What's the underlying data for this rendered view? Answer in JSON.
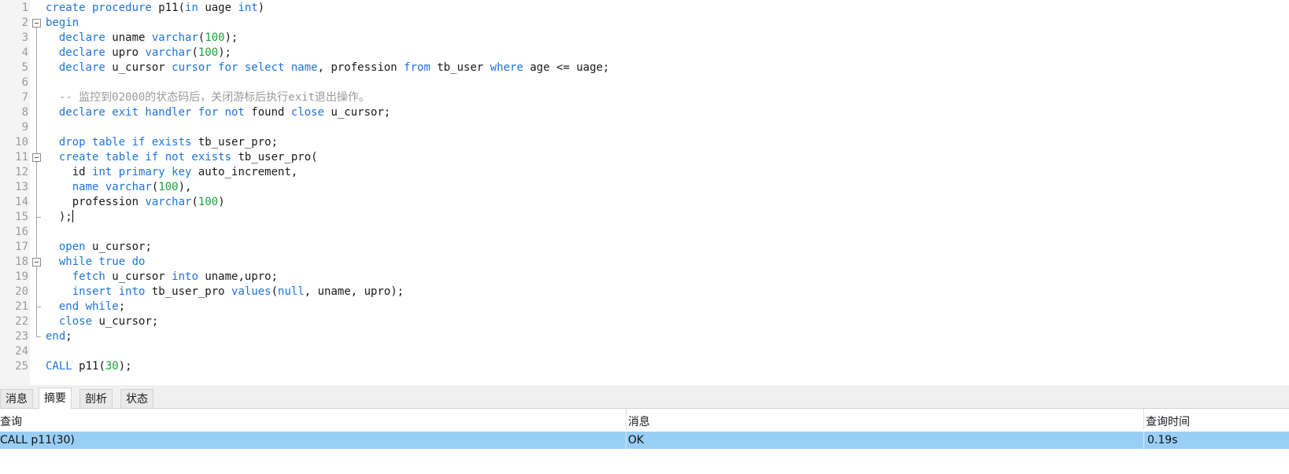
{
  "editor": {
    "lines": [
      {
        "n": "1",
        "t": [
          [
            "kw",
            "create procedure "
          ],
          [
            "pl",
            "p11("
          ],
          [
            "kw",
            "in "
          ],
          [
            "pl",
            "uage "
          ],
          [
            "kw",
            "int"
          ],
          [
            "pl",
            ")"
          ]
        ]
      },
      {
        "n": "2",
        "t": [
          [
            "kw",
            "begin"
          ]
        ]
      },
      {
        "n": "3",
        "t": [
          [
            "pl",
            "  "
          ],
          [
            "kw",
            "declare "
          ],
          [
            "pl",
            "uname "
          ],
          [
            "kw",
            "varchar"
          ],
          [
            "pl",
            "("
          ],
          [
            "num",
            "100"
          ],
          [
            "pl",
            ");"
          ]
        ]
      },
      {
        "n": "4",
        "t": [
          [
            "pl",
            "  "
          ],
          [
            "kw",
            "declare "
          ],
          [
            "pl",
            "upro "
          ],
          [
            "kw",
            "varchar"
          ],
          [
            "pl",
            "("
          ],
          [
            "num",
            "100"
          ],
          [
            "pl",
            ");"
          ]
        ]
      },
      {
        "n": "5",
        "t": [
          [
            "pl",
            "  "
          ],
          [
            "kw",
            "declare "
          ],
          [
            "pl",
            "u_cursor "
          ],
          [
            "kw",
            "cursor for select name"
          ],
          [
            "pl",
            ", profession "
          ],
          [
            "kw",
            "from "
          ],
          [
            "pl",
            "tb_user "
          ],
          [
            "kw",
            "where "
          ],
          [
            "pl",
            "age <= uage;"
          ]
        ]
      },
      {
        "n": "6",
        "t": []
      },
      {
        "n": "7",
        "t": [
          [
            "pl",
            "  "
          ],
          [
            "cmt",
            "-- 监控到02000的状态码后，关闭游标后执行exit退出操作。"
          ]
        ]
      },
      {
        "n": "8",
        "t": [
          [
            "pl",
            "  "
          ],
          [
            "kw",
            "declare exit handler for not "
          ],
          [
            "pl",
            "found "
          ],
          [
            "kw",
            "close "
          ],
          [
            "pl",
            "u_cursor;"
          ]
        ]
      },
      {
        "n": "9",
        "t": []
      },
      {
        "n": "10",
        "t": [
          [
            "pl",
            "  "
          ],
          [
            "kw",
            "drop table if exists "
          ],
          [
            "pl",
            "tb_user_pro;"
          ]
        ]
      },
      {
        "n": "11",
        "t": [
          [
            "pl",
            "  "
          ],
          [
            "kw",
            "create table if not exists "
          ],
          [
            "pl",
            "tb_user_pro("
          ]
        ]
      },
      {
        "n": "12",
        "t": [
          [
            "pl",
            "    id "
          ],
          [
            "kw",
            "int primary key "
          ],
          [
            "pl",
            "auto_increment,"
          ]
        ]
      },
      {
        "n": "13",
        "t": [
          [
            "pl",
            "    "
          ],
          [
            "kw",
            "name varchar"
          ],
          [
            "pl",
            "("
          ],
          [
            "num",
            "100"
          ],
          [
            "pl",
            "),"
          ]
        ]
      },
      {
        "n": "14",
        "t": [
          [
            "pl",
            "    profession "
          ],
          [
            "kw",
            "varchar"
          ],
          [
            "pl",
            "("
          ],
          [
            "num",
            "100"
          ],
          [
            "pl",
            ")"
          ]
        ]
      },
      {
        "n": "15",
        "t": [
          [
            "pl",
            "  );"
          ]
        ],
        "caret": true
      },
      {
        "n": "16",
        "t": []
      },
      {
        "n": "17",
        "t": [
          [
            "pl",
            "  "
          ],
          [
            "kw",
            "open "
          ],
          [
            "pl",
            "u_cursor;"
          ]
        ]
      },
      {
        "n": "18",
        "t": [
          [
            "pl",
            "  "
          ],
          [
            "kw",
            "while true do"
          ]
        ]
      },
      {
        "n": "19",
        "t": [
          [
            "pl",
            "    "
          ],
          [
            "kw",
            "fetch "
          ],
          [
            "pl",
            "u_cursor "
          ],
          [
            "kw",
            "into "
          ],
          [
            "pl",
            "uname,upro;"
          ]
        ]
      },
      {
        "n": "20",
        "t": [
          [
            "pl",
            "    "
          ],
          [
            "kw",
            "insert into "
          ],
          [
            "pl",
            "tb_user_pro "
          ],
          [
            "kw",
            "values"
          ],
          [
            "pl",
            "("
          ],
          [
            "kw",
            "null"
          ],
          [
            "pl",
            ", uname, upro);"
          ]
        ]
      },
      {
        "n": "21",
        "t": [
          [
            "pl",
            "  "
          ],
          [
            "kw",
            "end while"
          ],
          [
            "pl",
            ";"
          ]
        ]
      },
      {
        "n": "22",
        "t": [
          [
            "pl",
            "  "
          ],
          [
            "kw",
            "close "
          ],
          [
            "pl",
            "u_cursor;"
          ]
        ]
      },
      {
        "n": "23",
        "t": [
          [
            "kw",
            "end"
          ],
          [
            "pl",
            ";"
          ]
        ]
      },
      {
        "n": "24",
        "t": []
      },
      {
        "n": "25",
        "t": [
          [
            "kw",
            "CALL "
          ],
          [
            "pl",
            "p11("
          ],
          [
            "num",
            "30"
          ],
          [
            "pl",
            ");"
          ]
        ]
      }
    ],
    "folds": {
      "2": "box",
      "3": "line",
      "4": "line",
      "5": "line",
      "6": "line",
      "7": "line",
      "8": "line",
      "9": "line",
      "10": "line",
      "11": "box",
      "12": "line",
      "13": "line",
      "14": "line",
      "15": "tick",
      "16": "line",
      "17": "line",
      "18": "box",
      "19": "line",
      "20": "line",
      "21": "tick",
      "22": "line",
      "23": "end"
    }
  },
  "tabs": [
    {
      "label": "消息",
      "active": false
    },
    {
      "label": "摘要",
      "active": true
    },
    {
      "label": "剖析",
      "active": false
    },
    {
      "label": "状态",
      "active": false
    }
  ],
  "results": {
    "headers": {
      "query": "查询",
      "message": "消息",
      "time": "查询时间"
    },
    "row": {
      "query": "CALL p11(30)",
      "message": "OK",
      "time": "0.19s"
    }
  }
}
